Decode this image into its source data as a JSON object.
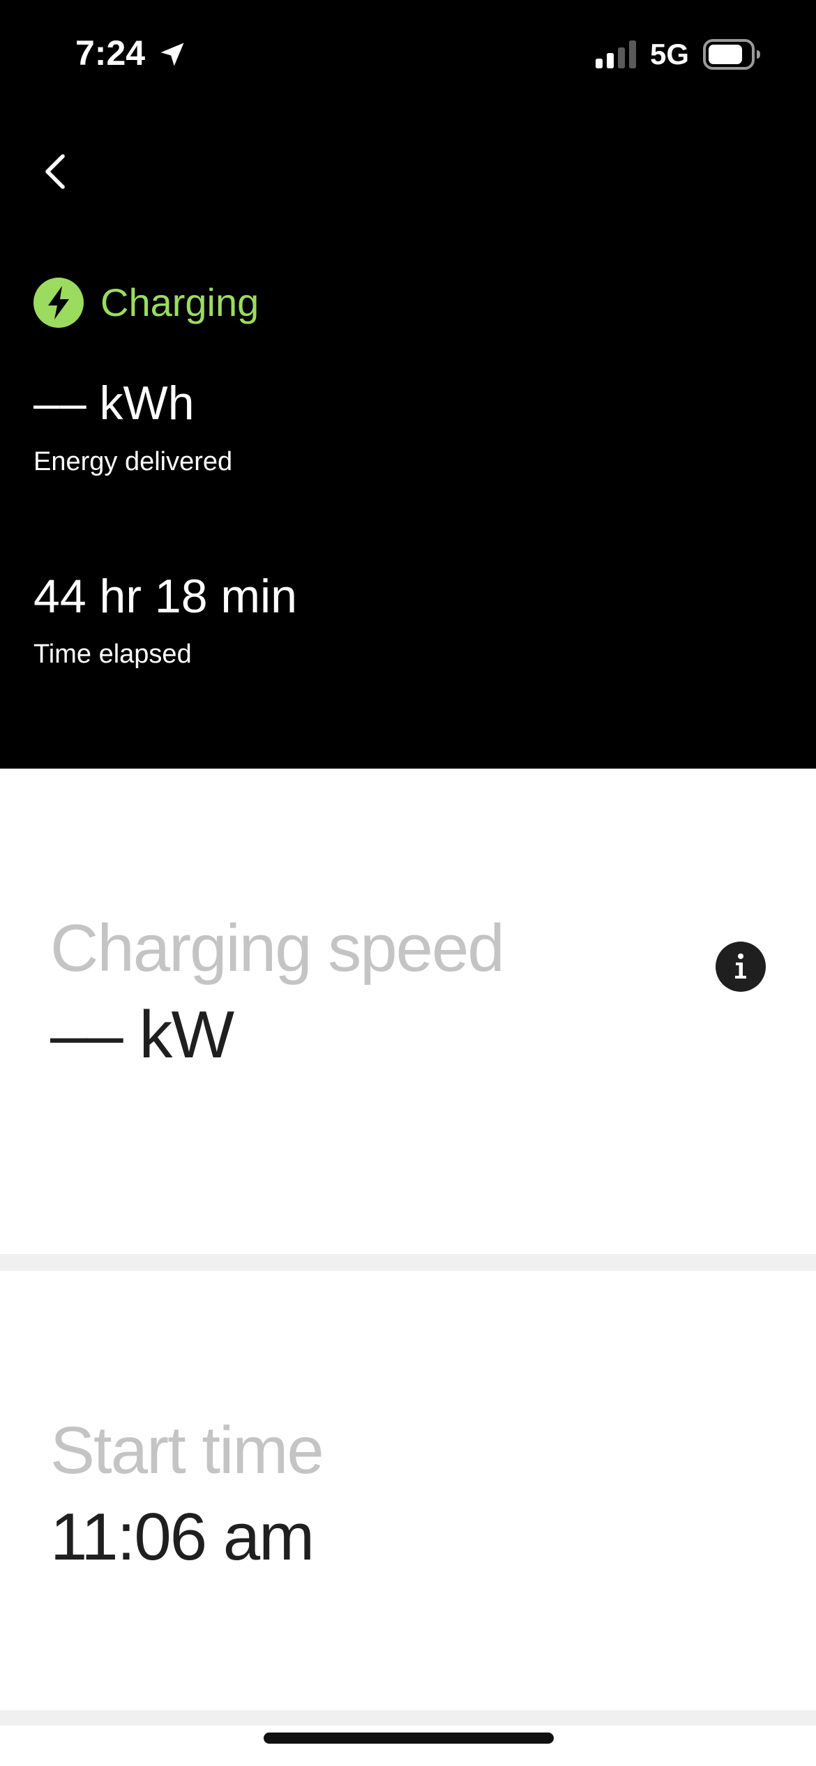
{
  "status_bar": {
    "time": "7:24",
    "network": "5G",
    "icons": [
      "location-arrow-icon",
      "signal-bars-icon",
      "battery-icon"
    ]
  },
  "nav": {
    "back_icon": "chevron-left-icon"
  },
  "session": {
    "status": "Charging",
    "status_icon": "lightning-bolt-icon",
    "status_color": "#9bdc5e",
    "energy_value": "–– kWh",
    "energy_label": "Energy delivered",
    "time_value": "44 hr 18 min",
    "time_label": "Time elapsed"
  },
  "cards": {
    "speed": {
      "title": "Charging speed",
      "value": "–– kW",
      "info_icon": "info-icon"
    },
    "start": {
      "title": "Start time",
      "value": "11:06 am"
    }
  }
}
